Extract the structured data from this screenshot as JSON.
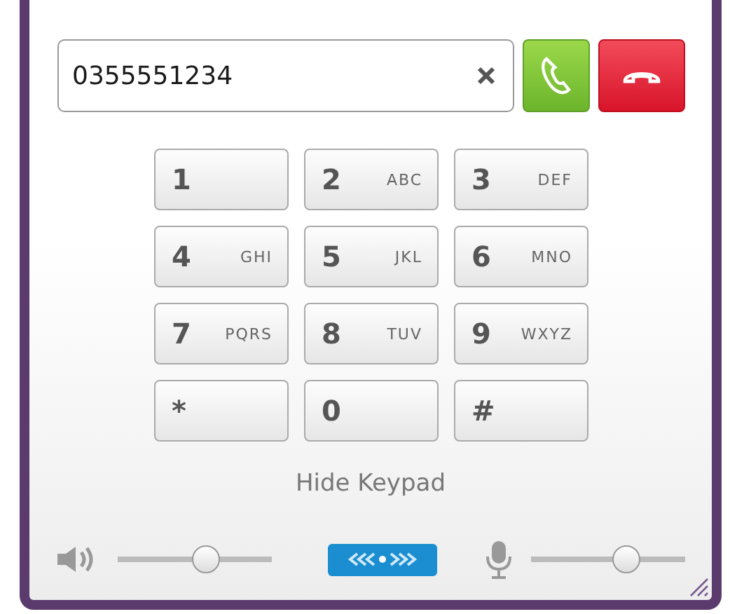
{
  "dial_field": {
    "value": "0355551234"
  },
  "keys": [
    {
      "digit": "1"
    },
    {
      "digit": "2",
      "letters": "ABC"
    },
    {
      "digit": "3",
      "letters": "DEF"
    },
    {
      "digit": "4",
      "letters": "GHI"
    },
    {
      "digit": "5",
      "letters": "JKL"
    },
    {
      "digit": "6",
      "letters": "MNO"
    },
    {
      "digit": "7",
      "letters": "PQRS"
    },
    {
      "digit": "8",
      "letters": "TUV"
    },
    {
      "digit": "9",
      "letters": "WXYZ"
    },
    {
      "digit": "*"
    },
    {
      "digit": "0"
    },
    {
      "digit": "#"
    }
  ],
  "toggle_link": "Hide Keypad",
  "speaker_volume": {
    "level": 0.57
  },
  "mic_volume": {
    "level": 0.62
  }
}
